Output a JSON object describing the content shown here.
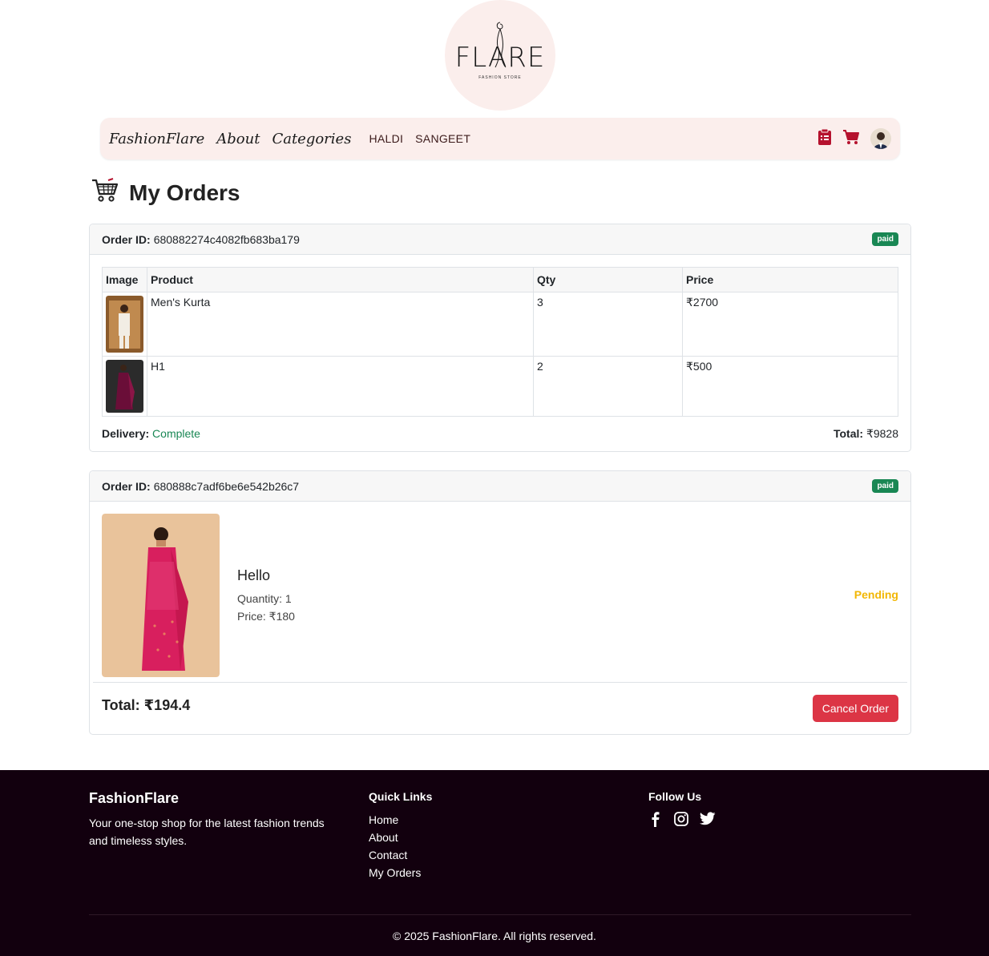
{
  "logo": {
    "text": "FLARE",
    "subtitle": "FASHION STORE"
  },
  "navbar": {
    "brand": "FashionFlare",
    "links": [
      "About",
      "Categories"
    ],
    "categories": [
      "HALDI",
      "SANGEET"
    ],
    "icons": [
      "orders-clipboard-icon",
      "cart-icon",
      "avatar"
    ]
  },
  "page": {
    "title": "My Orders",
    "title_icon": "cart-icon"
  },
  "orders": [
    {
      "id_label": "Order ID:",
      "id": "680882274c4082fb683ba179",
      "payment_badge": "paid",
      "table_headers": [
        "Image",
        "Product",
        "Qty",
        "Price"
      ],
      "items": [
        {
          "product": "Men's Kurta",
          "qty": "3",
          "price": "₹2700"
        },
        {
          "product": "H1",
          "qty": "2",
          "price": "₹500"
        }
      ],
      "delivery_label": "Delivery:",
      "delivery_status": "Complete",
      "total_label": "Total:",
      "total": "₹9828"
    },
    {
      "id_label": "Order ID:",
      "id": "680888c7adf6be6e542b26c7",
      "payment_badge": "paid",
      "item": {
        "name": "Hello",
        "quantity": "Quantity: 1",
        "price": "Price: ₹180",
        "status": "Pending"
      },
      "total": "Total: ₹194.4",
      "cancel_label": "Cancel Order"
    }
  ],
  "footer": {
    "brand": "FashionFlare",
    "tagline": "Your one-stop shop for the latest fashion trends and timeless styles.",
    "quick_links_title": "Quick Links",
    "quick_links": [
      "Home",
      "About",
      "Contact",
      "My Orders"
    ],
    "follow_title": "Follow Us",
    "social_icons": [
      "facebook-icon",
      "instagram-icon",
      "twitter-icon"
    ],
    "copyright": "© 2025 FashionFlare. All rights reserved."
  },
  "colors": {
    "accent_pink": "#fbeeec",
    "badge_green": "#198754",
    "delivery_green": "#198754",
    "pending_yellow": "#f2b705",
    "cancel_red": "#dc3545",
    "footer_bg": "#12000e",
    "icon_red": "#b5122e"
  }
}
